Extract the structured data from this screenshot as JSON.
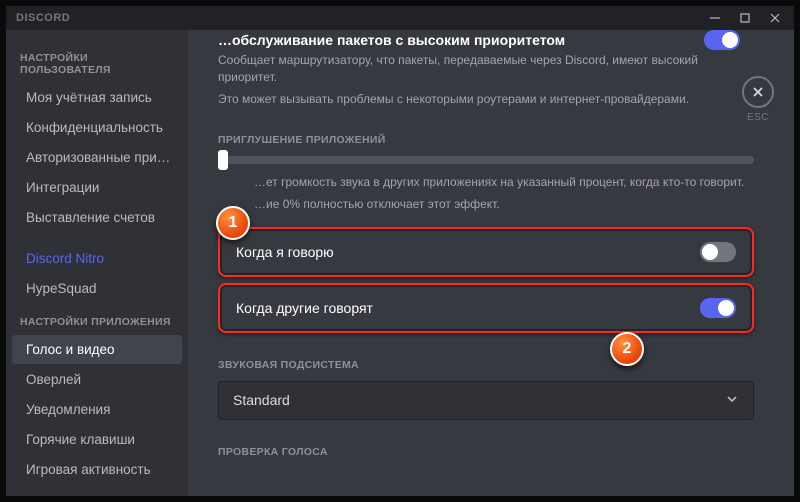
{
  "app": {
    "title": "DISCORD"
  },
  "esc": {
    "label": "ESC"
  },
  "sidebar": {
    "headers": {
      "user": "НАСТРОЙКИ ПОЛЬЗОВАТЕЛЯ",
      "app": "НАСТРОЙКИ ПРИЛОЖЕНИЯ"
    },
    "user_items": [
      "Моя учётная запись",
      "Конфиденциальность",
      "Авторизованные прил…",
      "Интеграции",
      "Выставление счетов"
    ],
    "nitro": "Discord Nitro",
    "hypesquad": "HypeSquad",
    "app_items": [
      "Голос и видео",
      "Оверлей",
      "Уведомления",
      "Горячие клавиши",
      "Игровая активность"
    ],
    "active_app_index": 0
  },
  "main": {
    "top_truncated_title": "…обслуживание пакетов с высоким приоритетом",
    "top_desc1": "Сообщает маршрутизатору, что пакеты, передаваемые через Discord, имеют высокий приоритет.",
    "top_desc2": "Это может вызывать проблемы с некоторыми роутерами и интернет-провайдерами.",
    "attenuation": {
      "header": "ПРИГЛУШЕНИЕ ПРИЛОЖЕНИЙ",
      "desc1": "…ет громкость звука в других приложениях на указанный процент, когда кто-то говорит.",
      "desc2": "…ие 0% полностью отключает этот эффект.",
      "slider_value": 0
    },
    "rows": {
      "when_i_speak": {
        "label": "Когда я говорю",
        "on": false
      },
      "when_others_speak": {
        "label": "Когда другие говорят",
        "on": true
      }
    },
    "audio_subsystem": {
      "header": "ЗВУКОВАЯ ПОДСИСТЕМА",
      "value": "Standard"
    },
    "voice_check_header": "ПРОВЕРКА ГОЛОСА"
  },
  "callouts": {
    "one": "1",
    "two": "2"
  }
}
